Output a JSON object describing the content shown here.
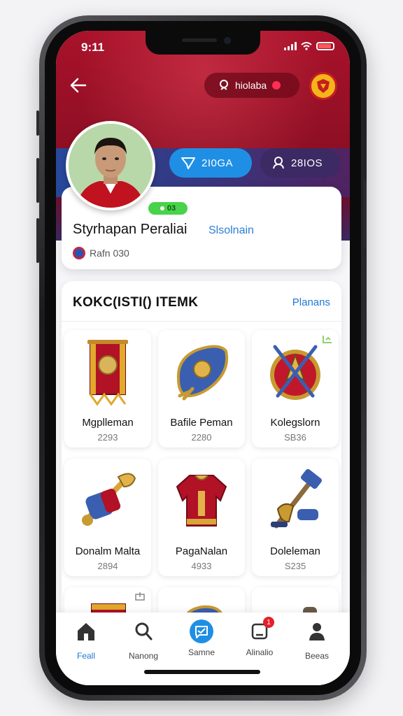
{
  "status": {
    "time": "9:11"
  },
  "header": {
    "search_text": "hiolaba"
  },
  "stats": [
    {
      "label": "2I0GA",
      "icon": "shield-icon"
    },
    {
      "label": "28IOS",
      "icon": "user-group-icon"
    }
  ],
  "profile": {
    "level": "03",
    "name": "Styrhapan Peraliai",
    "subtitle": "Slsolnain",
    "id_text": "Rafn 030"
  },
  "collection": {
    "title": "KOKC(ISTI() ITEMK",
    "link": "Planans",
    "items": [
      {
        "name": "Mgplleman",
        "value": "2293",
        "art": "banner"
      },
      {
        "name": "Bafile Peman",
        "value": "2280",
        "art": "shield"
      },
      {
        "name": "Kolegslorn",
        "value": "SB36",
        "art": "emblem"
      },
      {
        "name": "Donalm Malta",
        "value": "2894",
        "art": "horn"
      },
      {
        "name": "PagaNalan",
        "value": "4933",
        "art": "armor"
      },
      {
        "name": "Doleleman",
        "value": "S235",
        "art": "hammer"
      }
    ]
  },
  "nav": [
    {
      "label": "Feall",
      "icon": "home-icon",
      "active": true
    },
    {
      "label": "Nanong",
      "icon": "search-icon",
      "active": false
    },
    {
      "label": "Samne",
      "icon": "chat-icon",
      "active": false
    },
    {
      "label": "Alinalio",
      "icon": "notification-icon",
      "badge": "1",
      "active": false
    },
    {
      "label": "Beeas",
      "icon": "profile-icon",
      "active": false
    }
  ],
  "colors": {
    "hero_red": "#a8122a",
    "accent_blue": "#1f8fe5",
    "level_green": "#48d34a",
    "link_blue": "#1e77d4"
  }
}
